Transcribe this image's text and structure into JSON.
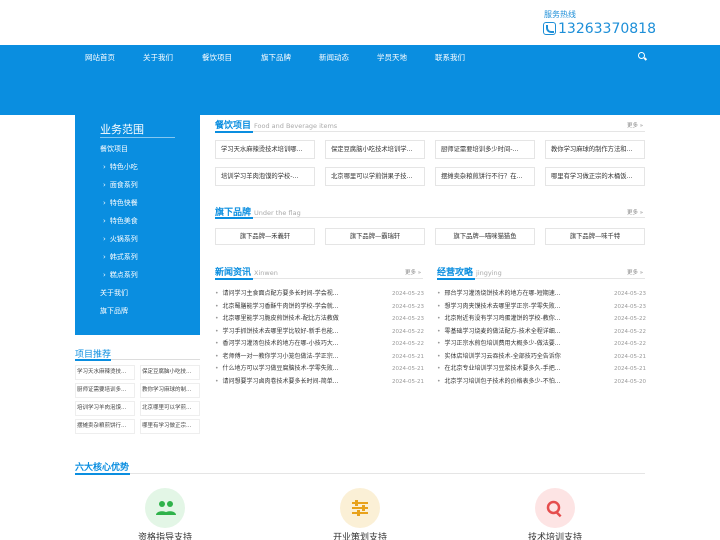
{
  "header": {
    "hotline_label": "服务热线",
    "hotline_number": "13263370818"
  },
  "nav": [
    "网站首页",
    "关于我们",
    "餐饮项目",
    "旗下品牌",
    "新闻动态",
    "学员天地",
    "联系我们"
  ],
  "sidebar": {
    "title": "业务范围",
    "items": [
      {
        "label": "餐饮项目",
        "sub": false
      },
      {
        "label": "特色小吃",
        "sub": true
      },
      {
        "label": "面食系列",
        "sub": true
      },
      {
        "label": "特色快餐",
        "sub": true
      },
      {
        "label": "特色美食",
        "sub": true
      },
      {
        "label": "火锅系列",
        "sub": true
      },
      {
        "label": "韩式系列",
        "sub": true
      },
      {
        "label": "糕点系列",
        "sub": true
      },
      {
        "label": "关于我们",
        "sub": false
      },
      {
        "label": "旗下品牌",
        "sub": false
      }
    ]
  },
  "projects": {
    "title": "项目推荐",
    "items": [
      "学习天水麻辣烫技...",
      "保定豆腐脑小吃技...",
      "厨师证需要培训多...",
      "教你学习麻球的制...",
      "培训学习羊肉泡馍...",
      "北京哪里可以学煎...",
      "摆摊卖杂粮煎饼行...",
      "哪里有学习做正宗..."
    ]
  },
  "catering": {
    "title": "餐饮项目",
    "subtitle": "Food and Beverage items",
    "more": "更多 »",
    "items": [
      "学习天水麻辣烫技术培训哪...",
      "保定豆腐脑小吃技术培训学...",
      "厨师证需要培训多少时间-...",
      "教你学习麻球的制作方法和...",
      "培训学习羊肉泡馍的学校-...",
      "北京哪里可以学煎饼果子技...",
      "摆摊卖杂粮煎饼行不行？在...",
      "哪里有学习做正宗的木桶饭..."
    ]
  },
  "brands": {
    "title": "旗下品牌",
    "subtitle": "Under the flag",
    "more": "更多 »",
    "items": [
      "旗下品牌—禾義轩",
      "旗下品牌—霸瑞轩",
      "旗下品牌—喵咪猫猫鱼",
      "旗下品牌—味千特"
    ]
  },
  "news": {
    "title": "新闻资讯",
    "subtitle": "Xinwen",
    "more": "更多 »",
    "items": [
      {
        "title": "请问学习主食面点配方要多长时间-学会视...",
        "date": "2024-05-23"
      },
      {
        "title": "北京蜀膳能学习香酥牛肉饼的学校-学会就...",
        "date": "2024-05-23"
      },
      {
        "title": "北京哪里能学习脆皮煎饼技术-配比方法教做",
        "date": "2024-05-23"
      },
      {
        "title": "学习手抓饼技术去哪里学比较好-新手也能...",
        "date": "2024-05-22"
      },
      {
        "title": "香河学习灌汤包技术的地方在哪-小技巧大...",
        "date": "2024-05-22"
      },
      {
        "title": "老师傅一对一教你学习小笼包做法-学正宗...",
        "date": "2024-05-21"
      },
      {
        "title": "什么地方可以学习做豆腐脑技术-学零失败...",
        "date": "2024-05-21"
      },
      {
        "title": "请问想要学习卤肉卷技术要多长时间-简单...",
        "date": "2024-05-21"
      }
    ]
  },
  "strategy": {
    "title": "经营攻略",
    "subtitle": "jingying",
    "more": "更多 »",
    "items": [
      {
        "title": "邢台学习灌汤烧饼技术的地方在哪-短期速...",
        "date": "2024-05-23"
      },
      {
        "title": "想学习肉夹馍技术去哪里学正宗-学零失败...",
        "date": "2024-05-23"
      },
      {
        "title": "北京附近有没有学习鸡蛋灌饼的学校-教你...",
        "date": "2024-05-22"
      },
      {
        "title": "零基础学习烧麦的做法配方-技术全程详细...",
        "date": "2024-05-22"
      },
      {
        "title": "学习正宗水煎包培训费用大概多少-做法要...",
        "date": "2024-05-22"
      },
      {
        "title": "实体店培训学习云吞技术-全部技巧全告诉你",
        "date": "2024-05-21"
      },
      {
        "title": "在北京专业培训学习豆浆技术要多久-手把...",
        "date": "2024-05-21"
      },
      {
        "title": "北京学习培训包子技术的价格表多少-不怕...",
        "date": "2024-05-20"
      }
    ]
  },
  "core": {
    "title": "六大核心优势",
    "items": [
      {
        "label": "资格指导支持",
        "color": "#e3f6e6",
        "icon_color": "#2fb24a",
        "icon": "users-icon"
      },
      {
        "label": "开业策划支持",
        "color": "#fbf0d6",
        "icon_color": "#e8a21b",
        "icon": "sliders-icon"
      },
      {
        "label": "技术培训支持",
        "color": "#fde4e4",
        "icon_color": "#e54d4d",
        "icon": "search-icon"
      }
    ]
  }
}
